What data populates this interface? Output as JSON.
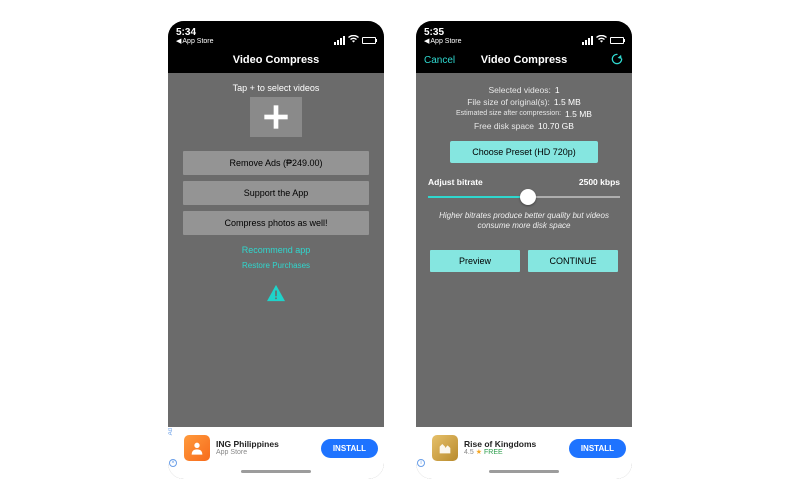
{
  "screen1": {
    "status": {
      "time": "5:34",
      "back": "App Store"
    },
    "nav": {
      "title": "Video Compress"
    },
    "tapLabel": "Tap + to select videos",
    "buttons": {
      "removeAds": "Remove Ads (₱249.00)",
      "support": "Support the App",
      "compressPhotos": "Compress photos as well!"
    },
    "links": {
      "recommend": "Recommend app",
      "restore": "Restore Purchases"
    },
    "ad": {
      "title": "ING Philippines",
      "subtitle": "App Store",
      "install": "INSTALL"
    }
  },
  "screen2": {
    "status": {
      "time": "5:35",
      "back": "App Store"
    },
    "nav": {
      "title": "Video Compress",
      "cancel": "Cancel"
    },
    "info": {
      "selectedLabel": "Selected videos:",
      "selectedValue": "1",
      "origLabel": "File size of original(s):",
      "origValue": "1.5 MB",
      "estLabel": "Estimated size after compression:",
      "estValue": "1.5 MB",
      "freeLabel": "Free disk space",
      "freeValue": "10.70 GB"
    },
    "presetBtn": "Choose Preset (HD 720p)",
    "bitrate": {
      "label": "Adjust bitrate",
      "value": "2500 kbps"
    },
    "hint": "Higher bitrates produce better quality but videos consume more disk space",
    "actions": {
      "preview": "Preview",
      "continue": "CONTINUE"
    },
    "ad": {
      "title": "Rise of Kingdoms",
      "rating": "4.5",
      "free": "FREE",
      "install": "INSTALL"
    }
  }
}
